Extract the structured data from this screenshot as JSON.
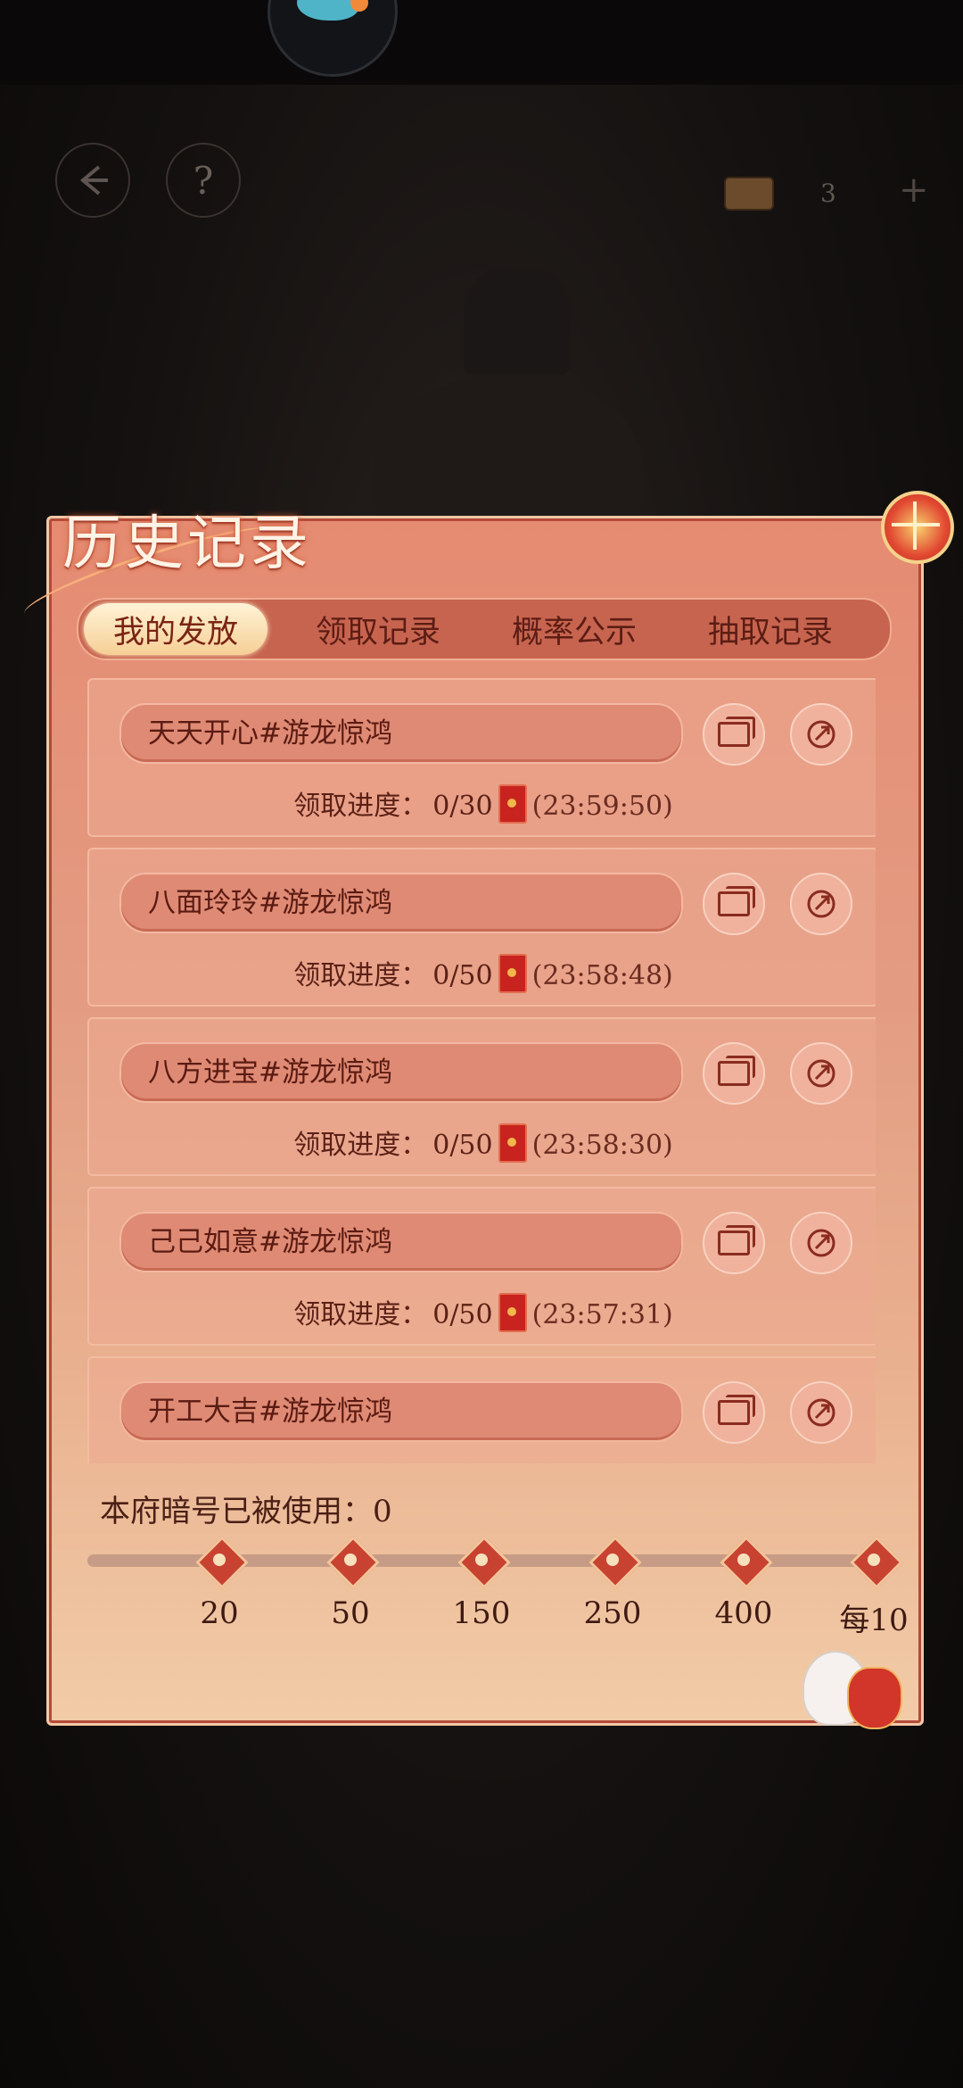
{
  "hud": {
    "back_icon": "back-arrow-icon",
    "help_label": "?",
    "counter_value": "3",
    "plus_label": "+"
  },
  "panel": {
    "title": "历史记录",
    "tabs": [
      {
        "label": "我的发放",
        "active": true
      },
      {
        "label": "领取记录",
        "active": false
      },
      {
        "label": "概率公示",
        "active": false
      },
      {
        "label": "抽取记录",
        "active": false
      }
    ],
    "progress_label": "领取进度：",
    "records": [
      {
        "name": "天天开心#游龙惊鸿",
        "progress": "0/30",
        "time": "(23:59:50)"
      },
      {
        "name": "八面玲玲#游龙惊鸿",
        "progress": "0/50",
        "time": "(23:58:48)"
      },
      {
        "name": "八方进宝#游龙惊鸿",
        "progress": "0/50",
        "time": "(23:58:30)"
      },
      {
        "name": "己己如意#游龙惊鸿",
        "progress": "0/50",
        "time": "(23:57:31)"
      },
      {
        "name": "开工大吉#游龙惊鸿",
        "progress": "",
        "time": ""
      }
    ],
    "used_label": "本府暗号已被使用：0",
    "milestones": [
      "20",
      "50",
      "150",
      "250",
      "400",
      "每10"
    ]
  },
  "colors": {
    "accent": "#e58b72",
    "tab_active": "#f6cf95",
    "text_dark": "#5a1b12"
  }
}
